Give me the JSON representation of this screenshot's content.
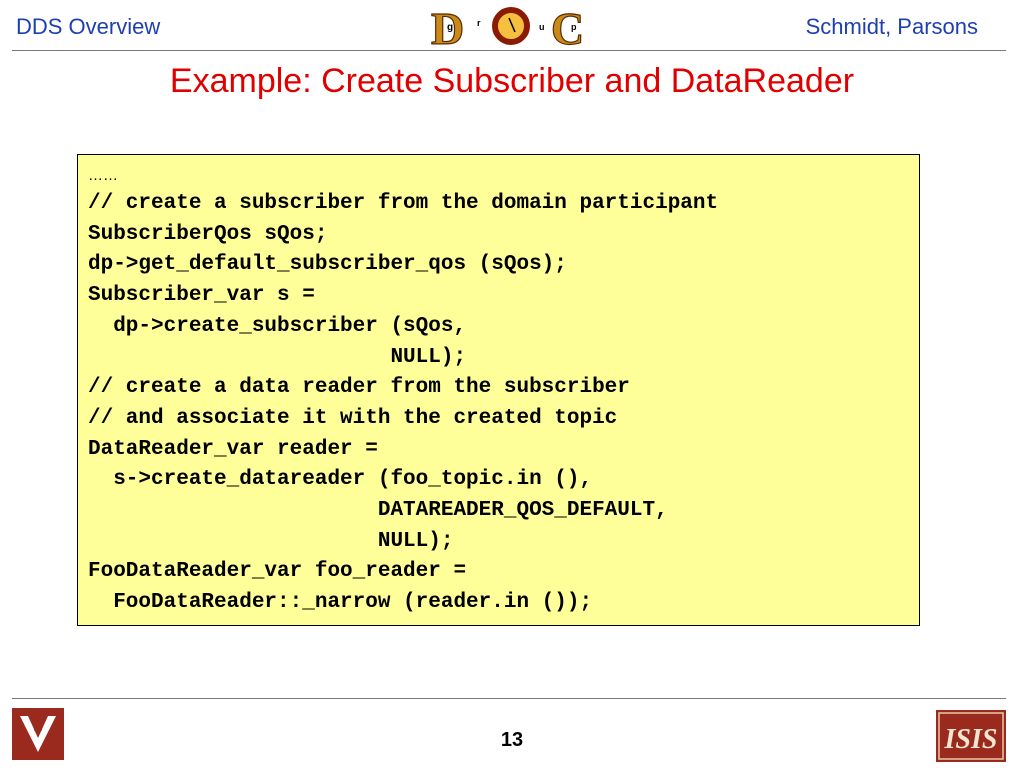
{
  "header": {
    "left": "DDS Overview",
    "right": "Schmidt, Parsons",
    "logo_letters": {
      "d": "D",
      "g": "g",
      "r": "r",
      "o": "o",
      "u": "u",
      "c": "C",
      "p": "p"
    }
  },
  "title": "Example: Create Subscriber and DataReader",
  "code": {
    "ellipsis": "……",
    "lines": [
      "// create a subscriber from the domain participant",
      "SubscriberQos sQos;",
      "dp->get_default_subscriber_qos (sQos);",
      "Subscriber_var s =",
      "  dp->create_subscriber (sQos,",
      "                        NULL);",
      "// create a data reader from the subscriber",
      "// and associate it with the created topic",
      "DataReader_var reader =",
      "  s->create_datareader (foo_topic.in (),",
      "                       DATAREADER_QOS_DEFAULT,",
      "                       NULL);",
      "FooDataReader_var foo_reader =",
      "  FooDataReader::_narrow (reader.in ());"
    ]
  },
  "footer": {
    "page_number": "13",
    "left_logo_text": "V",
    "right_logo_text": "ISIS"
  },
  "colors": {
    "header_text": "#1f3fb0",
    "title": "#e00000",
    "code_background": "#ffff99",
    "logo_maroon": "#9b2a1e",
    "logo_gold": "#e0a020"
  }
}
